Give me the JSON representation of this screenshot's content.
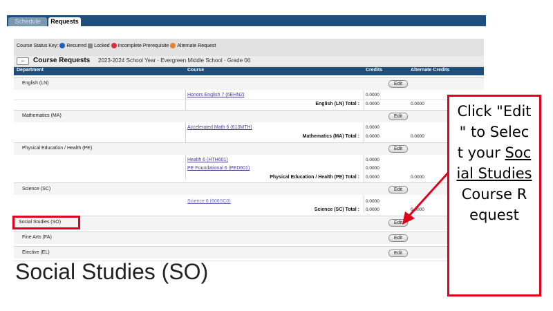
{
  "tabs": [
    {
      "label": "Schedule",
      "active": false
    },
    {
      "label": "Requests",
      "active": true
    }
  ],
  "status_key": {
    "label": "Course Status Key:",
    "items": [
      {
        "icon": "info-icon",
        "label": "Recurred"
      },
      {
        "icon": "lock-icon",
        "label": "Locked"
      },
      {
        "icon": "incomplete-icon",
        "label": "Incomplete Prerequisite"
      },
      {
        "icon": "alternate-icon",
        "label": "Alternate Request"
      }
    ]
  },
  "course_requests": {
    "collapse_symbol": "−",
    "title": "Course Requests",
    "subtitle": "2023-2024 School Year · Evergreen Middle School · Grade 06"
  },
  "columns": {
    "department": "Department",
    "course": "Course",
    "credits": "Credits",
    "alternate": "Alternate Credits"
  },
  "edit_label": "Edit",
  "departments": {
    "english": {
      "name": "English (LN)",
      "course": "Honors English 7 (6EHN2)",
      "credit": "0.0000",
      "total_label": "English (LN) Total :",
      "total_credit": "0.0000",
      "total_alt": "0.0000"
    },
    "math": {
      "name": "Mathematics (MA)",
      "course": "Accelerated Math 6 (613MTH)",
      "credit": "0.0000",
      "total_label": "Mathematics (MA) Total :",
      "total_credit": "0.0000",
      "total_alt": "0.0000"
    },
    "pe": {
      "name": "Physical Education / Health (PE)",
      "course1": "Health 6 (HTH601)",
      "credit1": "0.0000",
      "course2": "PE Foundational 6 (PED601)",
      "credit2": "0.0000",
      "total_label": "Physical Education / Health (PE) Total :",
      "total_credit": "0.0000",
      "total_alt": "0.0000"
    },
    "science": {
      "name": "Science (SC)",
      "course": "Science 6 (606SC0)",
      "credit": "0.0000",
      "total_label": "Science (SC) Total :",
      "total_credit": "0.0000",
      "total_alt": "0.0000"
    },
    "social": {
      "name": "Social Studies (SO)"
    },
    "fine_arts": {
      "name": "Fine Arts (FA)"
    },
    "elective": {
      "name": "Elective (EL)"
    }
  },
  "annotation": {
    "callout_lines": [
      "Click \"Edit",
      "\" to Selec",
      "t your ",
      "Soc",
      "ial Studies",
      " Course R",
      "equest"
    ],
    "caption": "Social Studies (SO)",
    "accent_color": "#e3001b"
  }
}
